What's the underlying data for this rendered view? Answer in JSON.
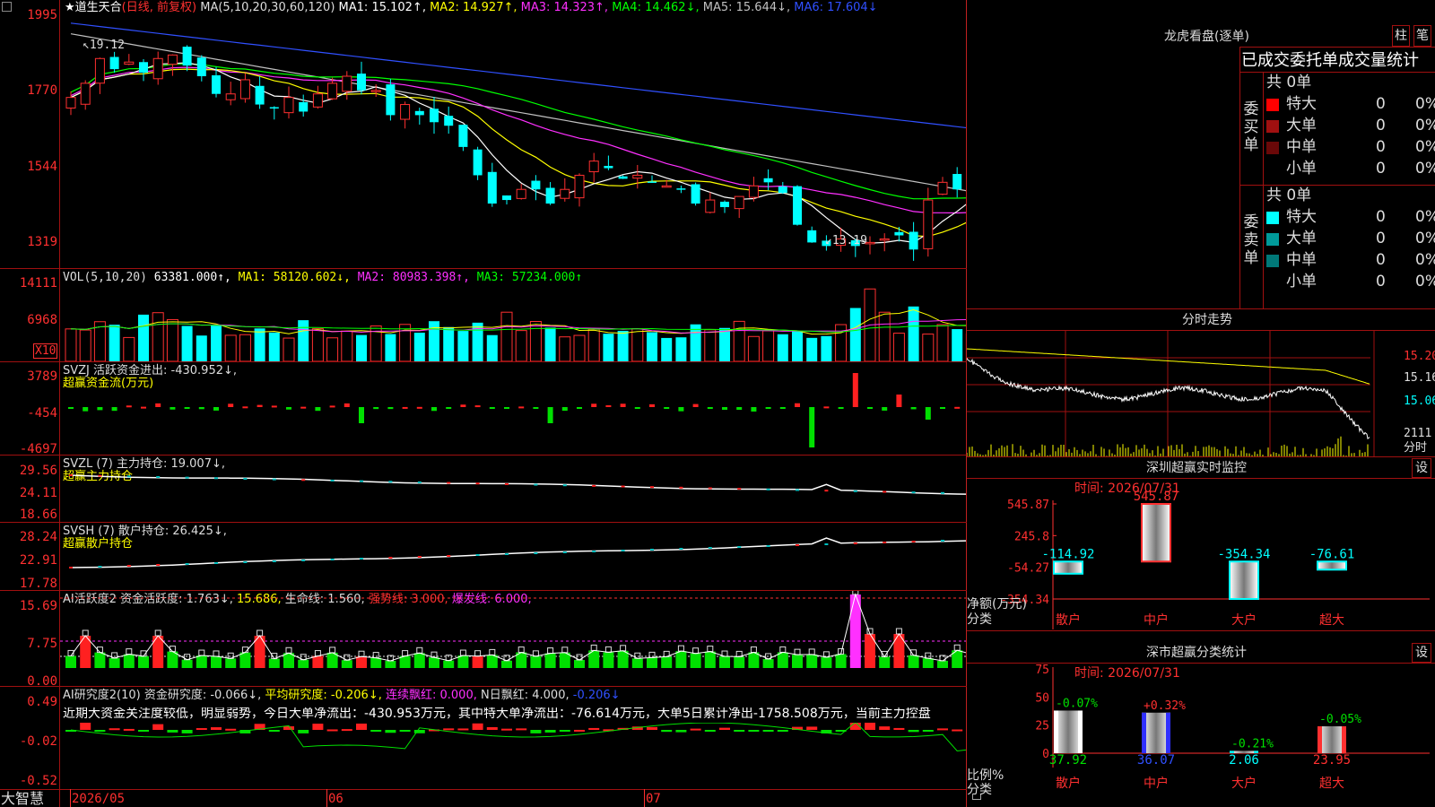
{
  "title": {
    "star": "★",
    "stock_name": "道生天合",
    "period": "(日线, 前复权)",
    "ma_label": "MA(5,10,20,30,60,120)",
    "ma1": "MA1: 15.102↑,",
    "ma2": "MA2: 14.927↑,",
    "ma3": "MA3: 14.323↑,",
    "ma4": "MA4: 14.462↓,",
    "ma5": "MA5: 15.644↓,",
    "ma6": "MA6: 17.604↓"
  },
  "colors": {
    "up": "#ff3030",
    "down": "#00ffff",
    "ma1": "#ffffff",
    "ma2": "#ffff00",
    "ma3": "#ff30ff",
    "ma4": "#00ff00",
    "ma5": "#c0c0c0",
    "ma6": "#3050ff",
    "grid": "#a01010"
  },
  "price_axis": [
    "1995",
    "1770",
    "1544",
    "1319"
  ],
  "price_marks": {
    "high": "19.12",
    "low": "13.19"
  },
  "vol": {
    "label": "VOL(5,10,20)",
    "value": "63381.000↑,",
    "ma1": "MA1: 58120.602↓,",
    "ma2": "MA2: 80983.398↑,",
    "ma3": "MA3: 57234.000↑",
    "axis": [
      "14111",
      "6968"
    ],
    "unit": "X10"
  },
  "svzj": {
    "label": "SVZJ",
    "text": "活跃资金进出: -430.952↓,",
    "sub": "超赢资金流(万元)",
    "axis": [
      "3789",
      "-454",
      "-4697"
    ]
  },
  "svzl": {
    "text": "SVZL (7) 主力持仓: 19.007↓,",
    "sub": "超赢主力持仓",
    "axis": [
      "29.56",
      "24.11",
      "18.66"
    ]
  },
  "svsh": {
    "text": "SVSH (7) 散户持仓: 26.425↓,",
    "sub": "超赢散户持仓",
    "axis": [
      "28.24",
      "22.91",
      "17.78"
    ]
  },
  "ai_active": {
    "t1": "AI活跃度2 资金活跃度: 1.763↓,",
    "t2": "15.686,",
    "t3": "生命线: 1.560,",
    "t4": "强势线: 3.000,",
    "t5": "爆发线: 6.000,",
    "axis": [
      "15.69",
      "7.75",
      "0.00"
    ]
  },
  "ai_research": {
    "t1": "AI研究度2(10) 资金研究度: -0.066↓,",
    "t2": "平均研究度: -0.206↓,",
    "t3": "连续飘红: 0.000,",
    "t4": "N日飘红: 4.000,",
    "t5": "-0.206↓",
    "comment": "近期大资金关注度较低，明显弱势，今日大单净流出：-430.953万元，其中特大单净流出：-76.614万元，大单5日累计净出-1758.508万元，当前主力控盘",
    "axis": [
      "0.49",
      "-0.02",
      "-0.52"
    ]
  },
  "bottom": {
    "brand": "大智慧",
    "d1": "2026/05",
    "d2": "06",
    "d3": "07"
  },
  "lhb": {
    "title": "龙虎看盘(逐单)",
    "tab1": "柱",
    "tab2": "笔",
    "header": "已成交委托单成交量统计",
    "buy_side": "委买单",
    "sell_side": "委卖单",
    "buy_total": "共 0单",
    "sell_total": "共 0单",
    "buy_rows": [
      {
        "name": "特大",
        "count": "0",
        "pct": "0%"
      },
      {
        "name": "大单",
        "count": "0",
        "pct": "0%"
      },
      {
        "name": "中单",
        "count": "0",
        "pct": "0%"
      },
      {
        "name": "小单",
        "count": "0",
        "pct": "0%"
      }
    ],
    "sell_rows": [
      {
        "name": "特大",
        "count": "0",
        "pct": "0%"
      },
      {
        "name": "大单",
        "count": "0",
        "pct": "0%"
      },
      {
        "name": "中单",
        "count": "0",
        "pct": "0%"
      },
      {
        "name": "小单",
        "count": "0",
        "pct": "0%"
      }
    ]
  },
  "intraday": {
    "title": "分时走势",
    "axis": [
      "15.20",
      "15.16",
      "15.06"
    ],
    "vol": "2111",
    "vol_unit": "分时"
  },
  "sz_monitor": {
    "title": "深圳超赢实时监控",
    "settings": "设",
    "time": "时间: 2026/07/31",
    "y_axis": [
      "545.87",
      "245.8",
      "-54.27",
      "-354.34"
    ],
    "ylabel": "净额(万元)",
    "xlabel": "分类",
    "categories": [
      "散户",
      "中户",
      "大户",
      "超大"
    ],
    "values": [
      "-114.92",
      "545.87",
      "-354.34",
      "-76.61"
    ],
    "nums": [
      -114.92,
      545.87,
      -354.34,
      -76.61
    ]
  },
  "sz_class": {
    "title": "深市超赢分类统计",
    "settings": "设",
    "time": "时间: 2026/07/31",
    "y_axis": [
      "75",
      "50",
      "25",
      "0"
    ],
    "ylabel": "比例%",
    "xlabel": "分类",
    "categories": [
      "散户",
      "中户",
      "大户",
      "超大"
    ],
    "pct_change": [
      "-0.07%",
      "+0.32%",
      "-0.21%",
      "-0.05%"
    ],
    "values": [
      "37.92",
      "36.07",
      "2.06",
      "23.95"
    ],
    "nums": [
      37.92,
      36.07,
      2.06,
      23.95
    ]
  }
}
